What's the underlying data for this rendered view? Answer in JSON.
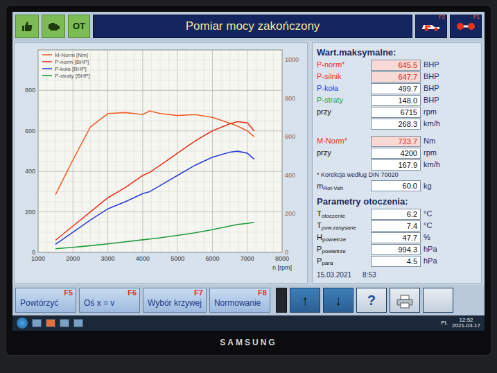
{
  "window": {
    "title": "Pomiar mocy zakończony"
  },
  "header": {
    "status_label": "OT",
    "function_keys": [
      {
        "key": "F2"
      },
      {
        "key": "F1"
      }
    ]
  },
  "max_values": {
    "title": "Wart.maksymalne:",
    "rows": [
      {
        "label": "P-norm*",
        "sub": "",
        "value": "645.5",
        "unit": "BHP",
        "color": "#e8321e",
        "highlight": true
      },
      {
        "label": "P-silnik",
        "sub": "",
        "value": "647.7",
        "unit": "BHP",
        "color": "#e8321e",
        "highlight": true
      },
      {
        "label": "P-koła",
        "sub": "",
        "value": "499.7",
        "unit": "BHP",
        "color": "#2a3fd6",
        "highlight": false
      },
      {
        "label": "P-straty",
        "sub": "",
        "value": "148.0",
        "unit": "BHP",
        "color": "#1e9a3a",
        "highlight": false
      },
      {
        "label": "przy",
        "sub": "",
        "value": "6715",
        "unit": "rpm",
        "color": "#111111",
        "highlight": false
      },
      {
        "label": "",
        "sub": "",
        "value": "268.3",
        "unit": "km/h",
        "color": "#111111",
        "highlight": false
      }
    ]
  },
  "torque": {
    "rows": [
      {
        "label": "M-Norm*",
        "sub": "",
        "value": "733.7",
        "unit": "Nm",
        "color": "#e8321e",
        "highlight": true
      },
      {
        "label": "przy",
        "sub": "",
        "value": "4200",
        "unit": "rpm",
        "color": "#111111",
        "highlight": false
      },
      {
        "label": "",
        "sub": "",
        "value": "167.9",
        "unit": "km/h",
        "color": "#111111",
        "highlight": false
      }
    ],
    "note": "* Korekcja według DIN 70020",
    "mass": {
      "label": "m",
      "sub": "Rot-Veh",
      "value": "60.0",
      "unit": "kg",
      "color": "#111111",
      "highlight": false
    }
  },
  "ambient": {
    "title": "Parametry otoczenia:",
    "rows": [
      {
        "label": "T",
        "sub": "otoczenie",
        "value": "6.2",
        "unit": "°C",
        "color": "#111111",
        "highlight": false
      },
      {
        "label": "T",
        "sub": "pow.zasysane",
        "value": "7.4",
        "unit": "°C",
        "color": "#111111",
        "highlight": false
      },
      {
        "label": "H",
        "sub": "powietrze",
        "value": "47.7",
        "unit": "%",
        "color": "#111111",
        "highlight": false
      },
      {
        "label": "P",
        "sub": "powietrze",
        "value": "994.3",
        "unit": "hPa",
        "color": "#111111",
        "highlight": false
      },
      {
        "label": "P",
        "sub": "para",
        "value": "4.5",
        "unit": "hPa",
        "color": "#111111",
        "highlight": false
      }
    ]
  },
  "timestamp": {
    "date": "15.03.2021",
    "time": "8:53"
  },
  "chart": {
    "x_unit": "n [rpm]",
    "x_ticks": [
      "1000",
      "2000",
      "3000",
      "4000",
      "5000",
      "6000",
      "7000",
      "8000"
    ],
    "left_ticks": [
      "0",
      "200",
      "400",
      "600",
      "800"
    ],
    "right_ticks": [
      "0",
      "200",
      "400",
      "600",
      "800",
      "1000"
    ],
    "rpm": [
      1500,
      2000,
      2500,
      3000,
      3500,
      4000,
      4200,
      4500,
      5000,
      5500,
      6000,
      6500,
      6715,
      7000,
      7200
    ],
    "series": [
      {
        "name": "M-Norm [Nm]",
        "axis": "right",
        "color": "#f0602a",
        "values": [
          300,
          480,
          650,
          720,
          725,
          715,
          733.7,
          720,
          710,
          715,
          700,
          670,
          655,
          630,
          600
        ]
      },
      {
        "name": "P-norm [BHP]",
        "axis": "left",
        "color": "#e8321e",
        "values": [
          60,
          130,
          200,
          270,
          320,
          380,
          395,
          430,
          490,
          550,
          600,
          635,
          645.5,
          640,
          600
        ]
      },
      {
        "name": "P-koła [BHP]",
        "axis": "left",
        "color": "#2a3fd6",
        "values": [
          40,
          100,
          160,
          215,
          250,
          290,
          300,
          330,
          380,
          430,
          470,
          495,
          499.7,
          490,
          460
        ]
      },
      {
        "name": "P-straty [BHP]",
        "axis": "left",
        "color": "#1e9a3a",
        "values": [
          18,
          25,
          33,
          42,
          52,
          62,
          66,
          72,
          84,
          97,
          112,
          130,
          138,
          143,
          148
        ]
      }
    ]
  },
  "bottom_buttons": [
    {
      "label": "Powtórzyć",
      "key": "F5"
    },
    {
      "label": "Oś x = v",
      "key": "F6"
    },
    {
      "label": "Wybór krzywej",
      "key": "F7"
    },
    {
      "label": "Normowanie",
      "key": "F8"
    }
  ],
  "level_meter": {
    "level": 0.6
  },
  "tool_buttons": [
    "↑",
    "↓",
    "?"
  ],
  "taskbar": {
    "keyboard": "PL",
    "time": "12:52",
    "date": "2021-03-17"
  },
  "monitor": {
    "brand": "SAMSUNG"
  }
}
